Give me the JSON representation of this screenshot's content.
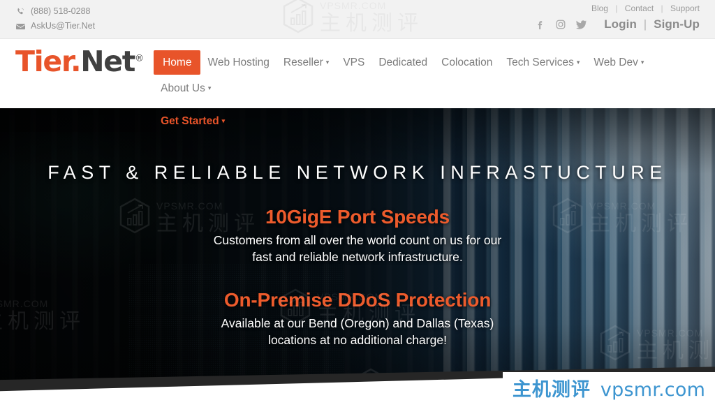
{
  "site": {
    "logo": {
      "part1": "Tier.",
      "part2": "Net",
      "trademark": "®"
    }
  },
  "topbar": {
    "phone": "(888) 518-0288",
    "email": "AskUs@Tier.Net",
    "phone_icon": "phone-icon",
    "email_icon": "envelope-icon",
    "util_links": [
      {
        "label": "Blog"
      },
      {
        "label": "Contact"
      },
      {
        "label": "Support"
      }
    ],
    "separator": "|",
    "socials": [
      {
        "name": "facebook-icon",
        "glyph": "f"
      },
      {
        "name": "instagram-icon",
        "glyph": ""
      },
      {
        "name": "twitter-icon",
        "glyph": ""
      }
    ],
    "login_label": "Login",
    "signup_label": "Sign-Up",
    "account_separator": "|"
  },
  "nav": {
    "items": [
      {
        "label": "Home",
        "active": true,
        "dropdown": false
      },
      {
        "label": "Web Hosting",
        "active": false,
        "dropdown": false
      },
      {
        "label": "Reseller",
        "active": false,
        "dropdown": true
      },
      {
        "label": "VPS",
        "active": false,
        "dropdown": false
      },
      {
        "label": "Dedicated",
        "active": false,
        "dropdown": false
      },
      {
        "label": "Colocation",
        "active": false,
        "dropdown": false
      },
      {
        "label": "Tech Services",
        "active": false,
        "dropdown": true
      },
      {
        "label": "Web Dev",
        "active": false,
        "dropdown": true
      },
      {
        "label": "About Us",
        "active": false,
        "dropdown": true
      }
    ],
    "get_started": {
      "label": "Get Started",
      "dropdown": true
    },
    "caret_glyph": "▾"
  },
  "hero": {
    "headline": "FAST & RELIABLE NETWORK INFRASTUCTURE",
    "blocks": [
      {
        "title": "10GigE Port Speeds",
        "line1": "Customers from all over the world count on us for our",
        "line2": "fast and reliable network infrastructure."
      },
      {
        "title": "On-Premise DDoS Protection",
        "line1": "Available at our Bend (Oregon) and Dallas (Texas)",
        "line2": "locations at no additional charge!"
      }
    ]
  },
  "watermarks": {
    "domain": "VPSMR.COM",
    "chinese": "主机测评"
  },
  "banner": {
    "chinese": "主机测评",
    "domain": "vpsmr.com"
  },
  "colors": {
    "accent_orange": "#e8542a",
    "hero_orange": "#ed5b2c",
    "topbar_bg": "#f2f2f2",
    "nav_text": "#7c7c7c",
    "logo_dark": "#404040",
    "banner_blue": "#3d95d0",
    "wedge_dark": "#262626"
  }
}
